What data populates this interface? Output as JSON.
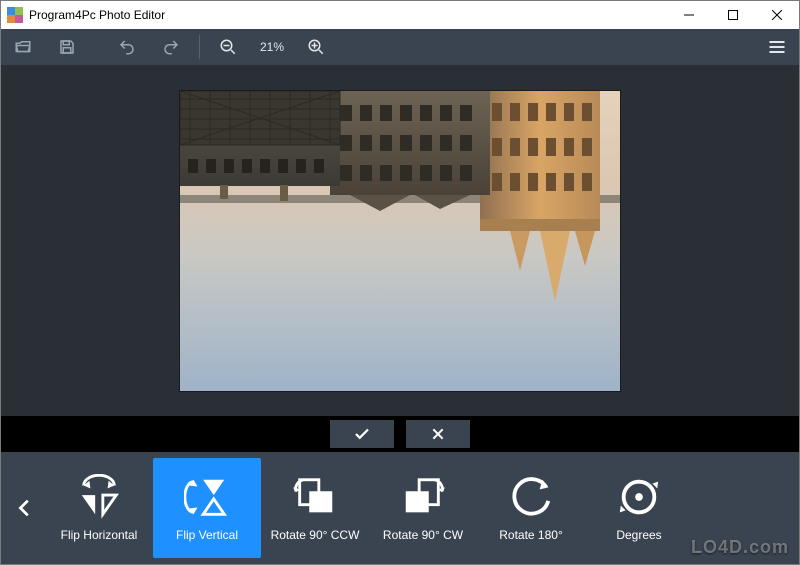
{
  "window": {
    "title": "Program4Pc Photo Editor"
  },
  "toolbar": {
    "zoom_label": "21%"
  },
  "confirm": {
    "accept_glyph": "✔",
    "cancel_glyph": "✖"
  },
  "actions": {
    "items": [
      {
        "label": "Flip Horizontal"
      },
      {
        "label": "Flip Vertical"
      },
      {
        "label": "Rotate 90° CCW"
      },
      {
        "label": "Rotate 90° CW"
      },
      {
        "label": "Rotate 180°"
      },
      {
        "label": "Degrees"
      }
    ],
    "active_index": 1
  },
  "watermark": "LO4D.com"
}
